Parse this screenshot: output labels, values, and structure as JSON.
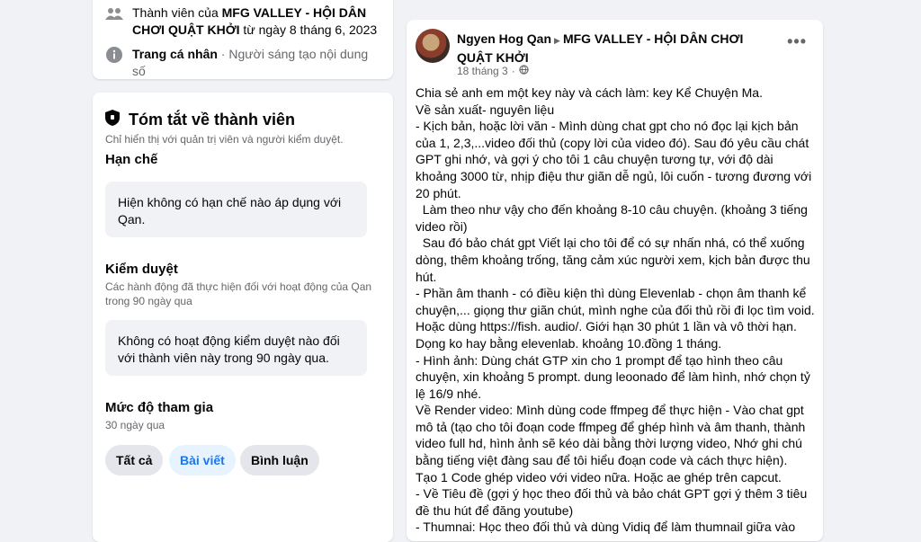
{
  "about": {
    "member_prefix": "Thành viên của ",
    "group_name": "MFG VALLEY - HỘI DÂN CHƠI QUẬT KHỞI",
    "member_suffix": " từ ngày 8 tháng 6, 2023",
    "profile_label": "Trang cá nhân",
    "profile_sep": " · ",
    "profile_value": "Người sáng tạo nội dung số"
  },
  "summary": {
    "title": "Tóm tắt về thành viên",
    "subtitle": "Chỉ hiển thị với quản trị viên và người kiểm duyệt.",
    "restrictions_title": "Hạn chế",
    "restrictions_text": "Hiện không có hạn chế nào áp dụng với Qan.",
    "moderation_title": "Kiểm duyệt",
    "moderation_subtitle": "Các hành động đã thực hiện đối với hoạt động của Qan trong 90 ngày qua",
    "moderation_text": "Không có hoạt động kiểm duyệt nào đối với thành viên này trong 90 ngày qua.",
    "engagement_title": "Mức độ tham gia",
    "engagement_subtitle": "30 ngày qua",
    "filters": [
      "Tất cả",
      "Bài viết",
      "Bình luận"
    ]
  },
  "post": {
    "author": "Ngyen Hog Qan",
    "group": "MFG VALLEY - HỘI DÂN CHƠI QUẬT KHỞI",
    "date": "18 tháng 3",
    "dot": "·",
    "more": "•••",
    "lines": [
      "Chia sẻ anh em một key này và cách làm: key Kể Chuyện Ma.",
      "Về sản xuất- nguyên liệu",
      "- Kịch bản, hoặc lời văn - Mình dùng chat gpt cho nó đọc lại kịch bản của 1, 2,3,...video đối thủ (copy lời của video đó). Sau đó yêu cầu chát GPT ghi nhớ, và gợi ý cho tôi 1 câu chuyện tương tự, với độ dài khoảng 3000 từ, nhịp điệu thư giãn dễ ngủ, lôi cuốn - tương đương với 20 phút.",
      "  Làm theo như vậy cho đến khoảng 8-10 câu chuyện. (khoảng 3 tiếng video rồi)",
      "  Sau đó bảo chát gpt Viết lại cho tôi để có sự nhấn nhá, có thể xuống dòng, thêm khoảng trống, tăng cảm xúc người xem, kịch bản được thu hút.",
      "- Phần âm thanh - có điều kiện thì dùng Elevenlab - chọn âm thanh kể chuyện,... giọng thư giãn chút, mình nghe của đối thủ rồi đi lọc tìm void. Hoặc dùng https://fish. audio/. Giới hạn 30 phút 1 lần và vô thời hạn. Dọng ko hay bằng elevenlab. khoảng 10.đồng 1 tháng.",
      "- Hình ảnh: Dùng chát GTP xin cho 1 prompt để tạo hình theo câu chuyện, xin khoảng 5 prompt. dung leoonado để làm hình, nhớ chọn tỷ lệ 16/9 nhé.",
      "Về Render video: Mình dùng code ffmpeg để thực hiện - Vào chat gpt mô tả (tạo cho tôi đoạn code ffmpeg để ghép hình và âm thanh, thành video full hd, hình ảnh sẽ kéo dài bằng thời lượng video, Nhớ ghi chú bằng tiếng việt đàng sau để tôi hiểu đoạn code và cách thực hiện).",
      "Tạo 1 Code ghép video với video nữa. Hoặc ae ghép trên capcut.",
      "- Về Tiêu đề (gợi ý học theo đối thủ và bảo chát GPT gợi ý thêm 3 tiêu đề thu hút để đăng youtube)",
      "- Thumnai: Học theo đối thủ và dùng Vidiq để làm thumnail giữa vào"
    ]
  }
}
